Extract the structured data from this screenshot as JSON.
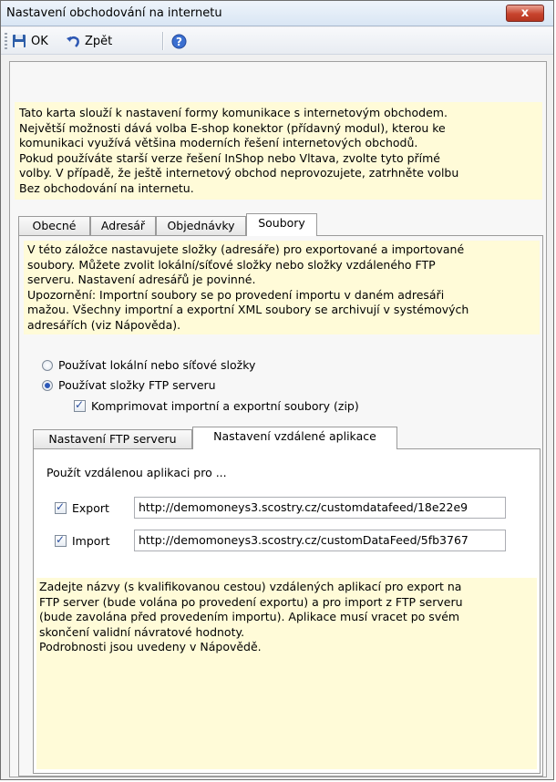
{
  "window": {
    "title": "Nastavení obchodování na internetu",
    "close_label": "x"
  },
  "toolbar": {
    "ok_label": "OK",
    "back_label": "Zpět",
    "help_icon": "help-icon"
  },
  "intro_text": [
    "Tato karta slouží k nastavení formy komunikace s internetovým obchodem.",
    "Největší možnosti dává volba E-shop konektor (přídavný modul), kterou ke",
    "komunikaci využívá většina moderních řešení internetových obchodů.",
    "Pokud používáte starší verze řešení InShop nebo Vltava, zvolte tyto přímé",
    "volby. V případě, že ještě internetový obchod neprovozujete, zatrhněte volbu",
    "Bez obchodování na internetu."
  ],
  "tabs": [
    {
      "label": "Obecné"
    },
    {
      "label": "Adresář"
    },
    {
      "label": "Objednávky"
    },
    {
      "label": "Soubory"
    }
  ],
  "soubory": {
    "info_text": [
      "V této záložce nastavujete složky (adresáře) pro exportované a importované",
      "soubory. Můžete zvolit lokální/síťové složky nebo složky vzdáleného FTP",
      "serveru. Nastavení adresářů je povinné.",
      "Upozornění: Importní soubory se po provedení importu v daném adresáři",
      "mažou. Všechny importní a exportní XML soubory se archivují v systémových",
      "adresářích (viz Nápověda)."
    ],
    "radio_local": "Používat lokální nebo síťové složky",
    "radio_ftp": "Používat složky FTP serveru",
    "selected": "ftp",
    "compress_label": "Komprimovat importní a exportní soubory (zip)",
    "compress_checked": true
  },
  "subtabs": [
    {
      "label": "Nastavení FTP serveru"
    },
    {
      "label": "Nastavení vzdálené aplikace"
    }
  ],
  "remote": {
    "heading": "Použít vzdálenou aplikaci pro ...",
    "export_label": "Export",
    "export_checked": true,
    "export_url": "http://demomoneys3.scostry.cz/customdatafeed/18e22e9",
    "import_label": "Import",
    "import_checked": true,
    "import_url": "http://demomoneys3.scostry.cz/customDataFeed/5fb3767",
    "note_text": [
      "Zadejte názvy (s kvalifikovanou cestou) vzdálených aplikací pro export na",
      "FTP server (bude volána po provedení exportu) a pro import z FTP serveru",
      "(bude zavolána před provedením importu). Aplikace musí vracet po svém",
      "skončení validní návratové hodnoty.",
      "Podrobnosti jsou uvedeny v Nápovědě."
    ]
  },
  "colors": {
    "note_bg": "#fffbd8",
    "close_button": "#c7432d"
  }
}
